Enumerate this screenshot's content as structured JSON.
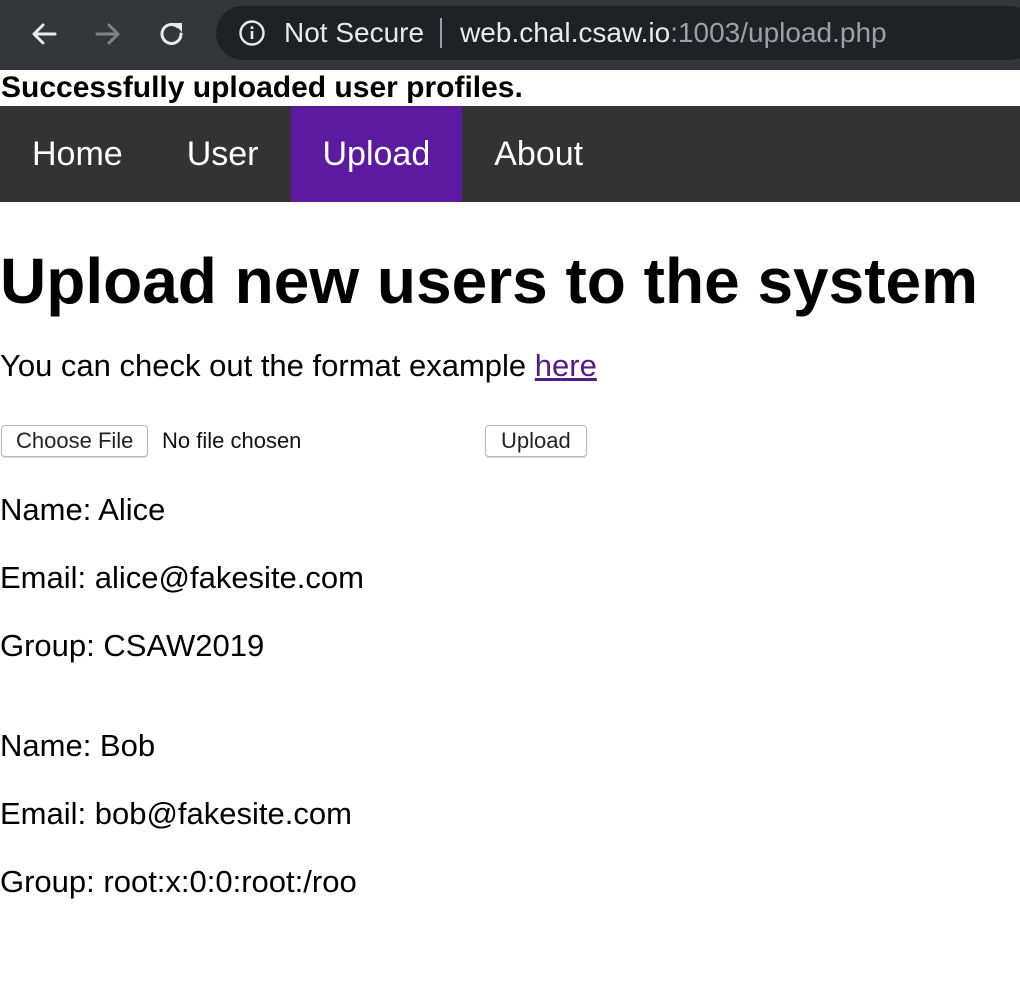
{
  "browser": {
    "security_label": "Not Secure",
    "url_host": "web.chal.csaw.io",
    "url_rest": ":1003/upload.php"
  },
  "flash_message": "Successfully uploaded user profiles.",
  "nav": {
    "items": [
      {
        "label": "Home"
      },
      {
        "label": "User"
      },
      {
        "label": "Upload"
      },
      {
        "label": "About"
      }
    ],
    "active": "Upload",
    "active_color": "#5c1aa1",
    "bar_color": "#333333"
  },
  "main": {
    "title": "Upload new users to the system",
    "format_text": "You can check out the format example ",
    "format_link": "here",
    "choose_file_label": "Choose File",
    "file_status": "No file chosen",
    "upload_label": "Upload"
  },
  "profiles": [
    {
      "name_line": "Name: Alice",
      "email_line": "Email: alice@fakesite.com",
      "group_line": "Group: CSAW2019"
    },
    {
      "name_line": "Name: Bob",
      "email_line": "Email: bob@fakesite.com",
      "group_line": "Group: root:x:0:0:root:/roo"
    }
  ]
}
